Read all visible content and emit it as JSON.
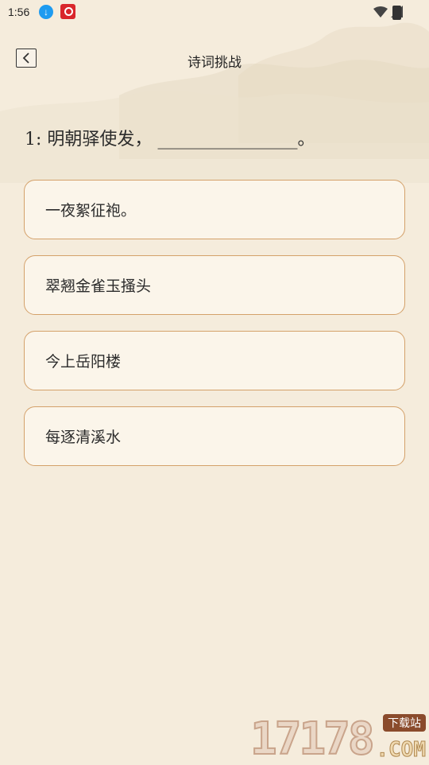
{
  "status_bar": {
    "time": "1:56",
    "app_icons": [
      "download-app-icon",
      "red-app-icon"
    ]
  },
  "header": {
    "title": "诗词挑战",
    "back_icon": "chevron-left-icon"
  },
  "question": {
    "number": "1:",
    "text": "明朝驿使发，",
    "blank": "________________",
    "end_mark": "。"
  },
  "options": [
    {
      "label": "一夜絮征袍。"
    },
    {
      "label": "翠翘金雀玉搔头"
    },
    {
      "label": "今上岳阳楼"
    },
    {
      "label": "每逐清溪水"
    }
  ],
  "watermark": {
    "digits": "17178",
    "domain": ".COM",
    "badge": "下载站"
  },
  "colors": {
    "background": "#f5ecdc",
    "option_border": "#d4a16a",
    "option_fill": "#fbf5ea",
    "text": "#2b2b2b"
  }
}
